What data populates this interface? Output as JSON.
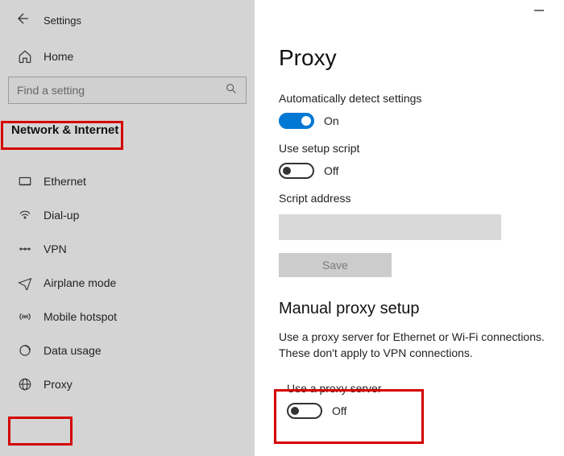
{
  "window": {
    "title": "Settings"
  },
  "sidebar": {
    "home_label": "Home",
    "search_placeholder": "Find a setting",
    "section_title": "Network & Internet",
    "items": [
      {
        "label": "Ethernet"
      },
      {
        "label": "Dial-up"
      },
      {
        "label": "VPN"
      },
      {
        "label": "Airplane mode"
      },
      {
        "label": "Mobile hotspot"
      },
      {
        "label": "Data usage"
      },
      {
        "label": "Proxy"
      }
    ]
  },
  "page": {
    "title": "Proxy",
    "auto_detect": {
      "label": "Automatically detect settings",
      "state": "On"
    },
    "setup_script": {
      "label": "Use setup script",
      "state": "Off"
    },
    "script_address": {
      "label": "Script address",
      "value": ""
    },
    "save_label": "Save",
    "manual_section_title": "Manual proxy setup",
    "manual_desc": "Use a proxy server for Ethernet or Wi-Fi connections. These don't apply to VPN connections.",
    "use_proxy": {
      "label": "Use a proxy server",
      "state": "Off"
    }
  }
}
